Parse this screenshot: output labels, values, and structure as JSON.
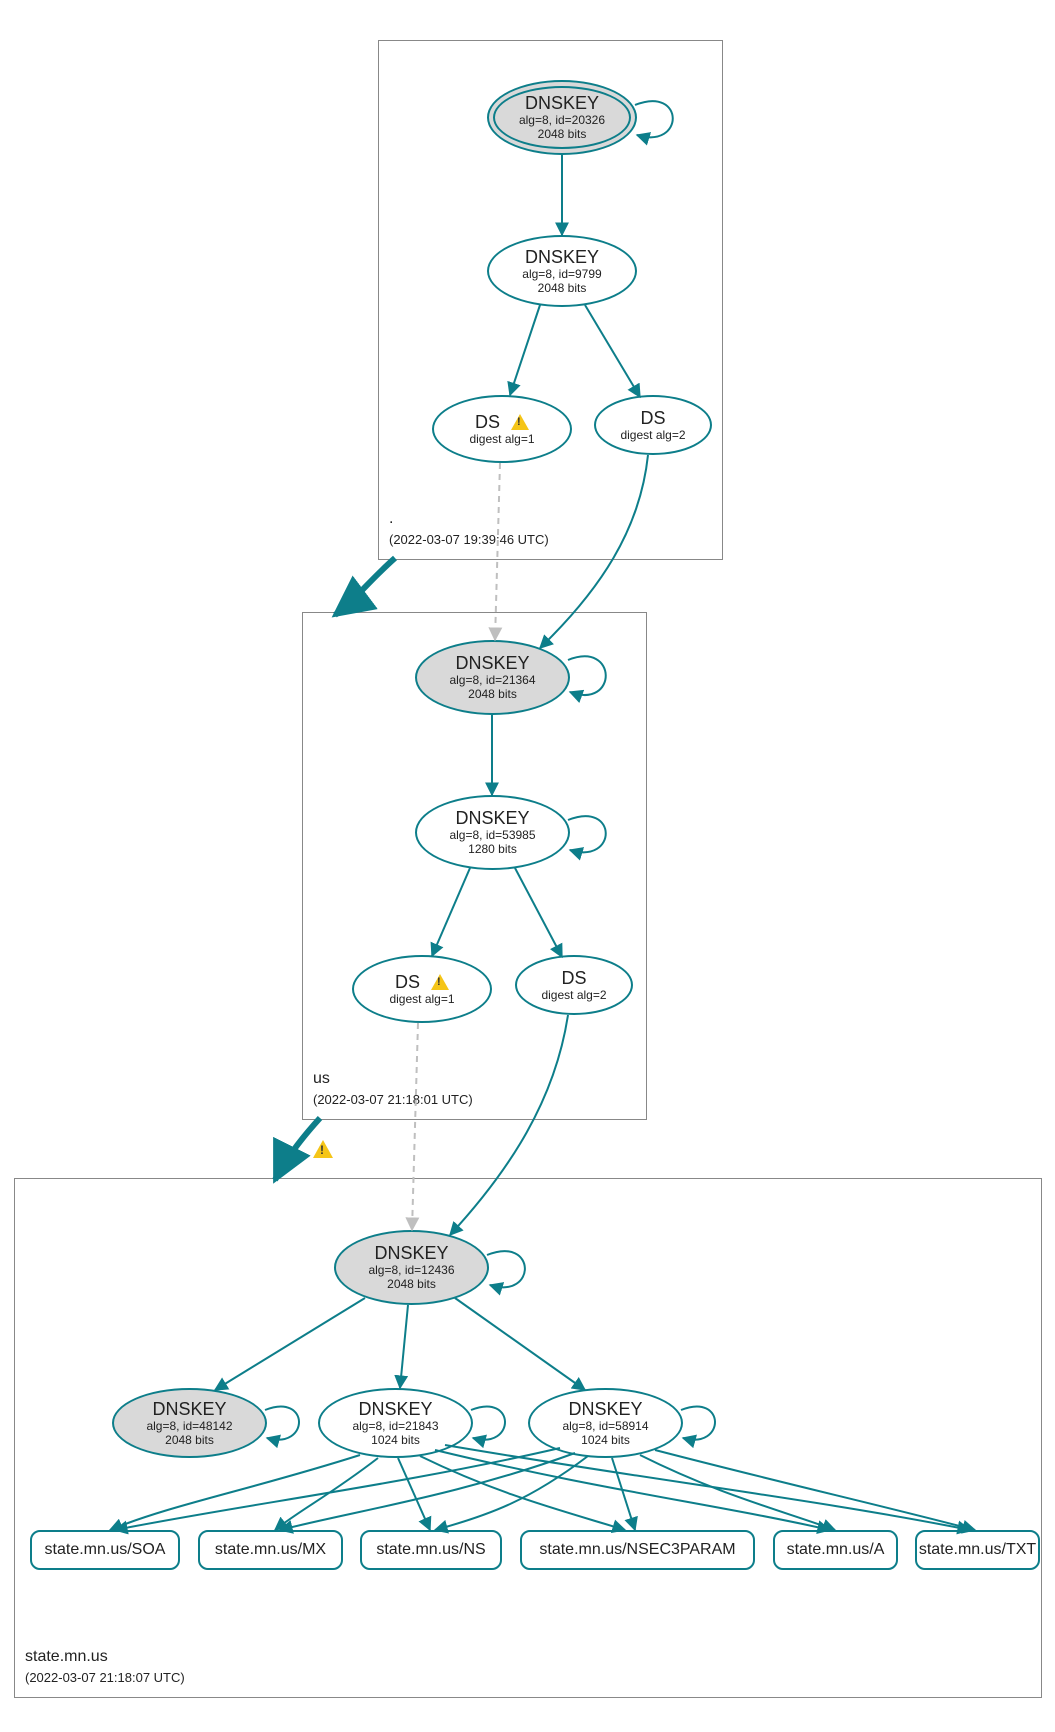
{
  "zones": {
    "root": {
      "name": ".",
      "timestamp": "(2022-03-07 19:39:46 UTC)"
    },
    "us": {
      "name": "us",
      "timestamp": "(2022-03-07 21:18:01 UTC)"
    },
    "state": {
      "name": "state.mn.us",
      "timestamp": "(2022-03-07 21:18:07 UTC)"
    }
  },
  "nodes": {
    "root_ksk": {
      "title": "DNSKEY",
      "line1": "alg=8, id=20326",
      "line2": "2048 bits"
    },
    "root_zsk": {
      "title": "DNSKEY",
      "line1": "alg=8, id=9799",
      "line2": "2048 bits"
    },
    "root_ds1": {
      "title": "DS",
      "line1": "digest alg=1"
    },
    "root_ds2": {
      "title": "DS",
      "line1": "digest alg=2"
    },
    "us_ksk": {
      "title": "DNSKEY",
      "line1": "alg=8, id=21364",
      "line2": "2048 bits"
    },
    "us_zsk": {
      "title": "DNSKEY",
      "line1": "alg=8, id=53985",
      "line2": "1280 bits"
    },
    "us_ds1": {
      "title": "DS",
      "line1": "digest alg=1"
    },
    "us_ds2": {
      "title": "DS",
      "line1": "digest alg=2"
    },
    "st_ksk": {
      "title": "DNSKEY",
      "line1": "alg=8, id=12436",
      "line2": "2048 bits"
    },
    "st_k48142": {
      "title": "DNSKEY",
      "line1": "alg=8, id=48142",
      "line2": "2048 bits"
    },
    "st_k21843": {
      "title": "DNSKEY",
      "line1": "alg=8, id=21843",
      "line2": "1024 bits"
    },
    "st_k58914": {
      "title": "DNSKEY",
      "line1": "alg=8, id=58914",
      "line2": "1024 bits"
    }
  },
  "rr": {
    "soa": "state.mn.us/SOA",
    "mx": "state.mn.us/MX",
    "ns": "state.mn.us/NS",
    "nsec3": "state.mn.us/NSEC3PARAM",
    "a": "state.mn.us/A",
    "txt": "state.mn.us/TXT"
  },
  "colors": {
    "stroke": "#0d7e8a"
  }
}
